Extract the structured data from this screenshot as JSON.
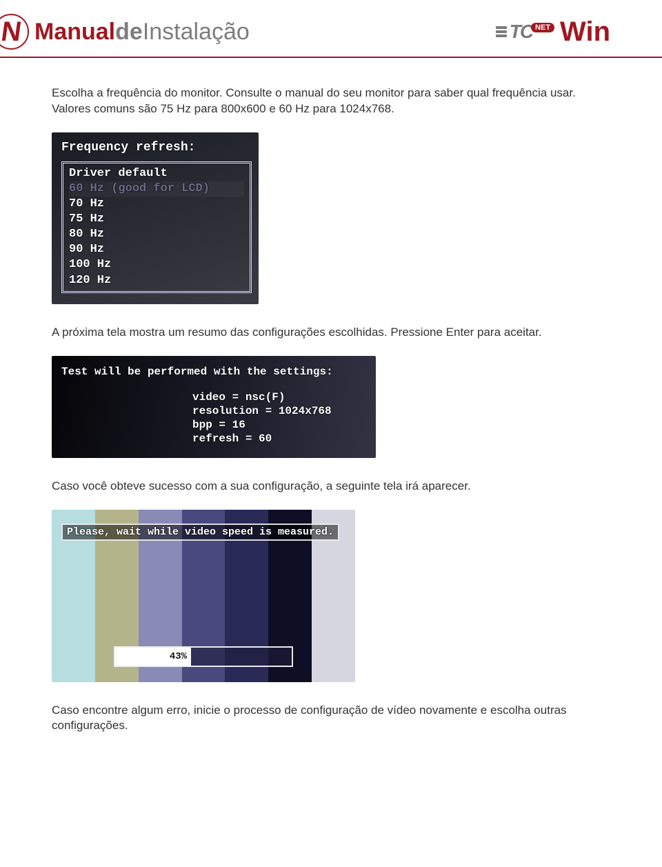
{
  "header": {
    "title_part1": "Manual",
    "title_part2": "de",
    "title_part3": "Instalação",
    "brand_tc": "TC",
    "brand_net": "NET",
    "brand_win": "Win"
  },
  "para1": "Escolha a frequência do monitor. Consulte o manual do seu monitor para saber qual frequência usar. Valores comuns são 75 Hz para 800x600 e 60 Hz para 1024x768.",
  "shot1": {
    "title": "Frequency refresh:",
    "items": [
      "Driver default",
      "60 Hz (good for LCD)",
      "70 Hz",
      "75 Hz",
      "80 Hz",
      "90 Hz",
      "100 Hz",
      "120 Hz"
    ],
    "selected_index": 1
  },
  "para2": "A próxima tela mostra um resumo das configurações escolhidas. Pressione Enter para aceitar.",
  "shot2": {
    "title": "Test will be performed with the settings:",
    "lines": [
      "video = nsc(F)",
      "resolution = 1024x768",
      "bpp = 16",
      "refresh = 60"
    ]
  },
  "para3": "Caso você obteve sucesso com a sua configuração, a seguinte tela irá aparecer.",
  "shot3": {
    "message": "Please, wait while video speed is measured.",
    "progress_label": "43%",
    "bars": [
      "#b6dde0",
      "#b4b48a",
      "#8a8ab6",
      "#49497f",
      "#2a2a58",
      "#0e0e24",
      "#d6d6e0"
    ]
  },
  "para4": "Caso encontre algum erro, inicie o processo de configuração de vídeo novamente e escolha outras configurações."
}
